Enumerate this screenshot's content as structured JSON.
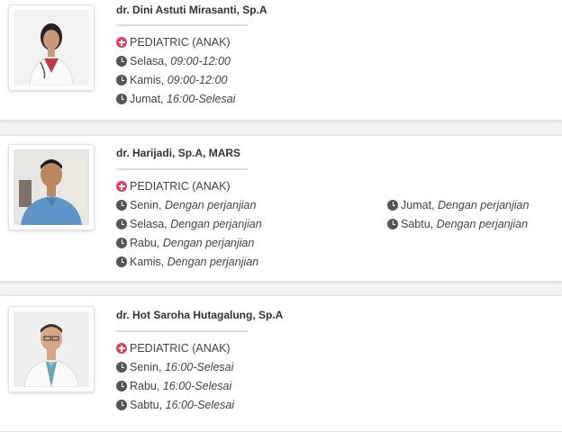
{
  "doctors": [
    {
      "name": "dr. Dini Astuti Mirasanti, Sp.A",
      "specialty": "PEDIATRIC (ANAK)",
      "schedule": [
        {
          "day": "Selasa,",
          "time": "09:00-12:00"
        },
        {
          "day": "Kamis,",
          "time": "09:00-12:00"
        },
        {
          "day": "Jumat,",
          "time": "16:00-Selesai"
        }
      ]
    },
    {
      "name": "dr. Harijadi, Sp.A, MARS",
      "specialty": "PEDIATRIC (ANAK)",
      "schedule": [
        {
          "day": "Senin,",
          "time": "Dengan perjanjian"
        },
        {
          "day": "Selasa,",
          "time": "Dengan perjanjian"
        },
        {
          "day": "Rabu,",
          "time": "Dengan perjanjian"
        },
        {
          "day": "Kamis,",
          "time": "Dengan perjanjian"
        },
        {
          "day": "Jumat,",
          "time": "Dengan perjanjian"
        },
        {
          "day": "Sabtu,",
          "time": "Dengan perjanjian"
        }
      ]
    },
    {
      "name": "dr. Hot Saroha Hutagalung, Sp.A",
      "specialty": "PEDIATRIC (ANAK)",
      "schedule": [
        {
          "day": "Senin,",
          "time": "16:00-Selesai"
        },
        {
          "day": "Rabu,",
          "time": "16:00-Selesai"
        },
        {
          "day": "Sabtu,",
          "time": "16:00-Selesai"
        }
      ]
    }
  ],
  "icons": {
    "specialty": "plus-circle-icon",
    "schedule": "clock-icon"
  },
  "colors": {
    "accent": "#e0415b"
  }
}
